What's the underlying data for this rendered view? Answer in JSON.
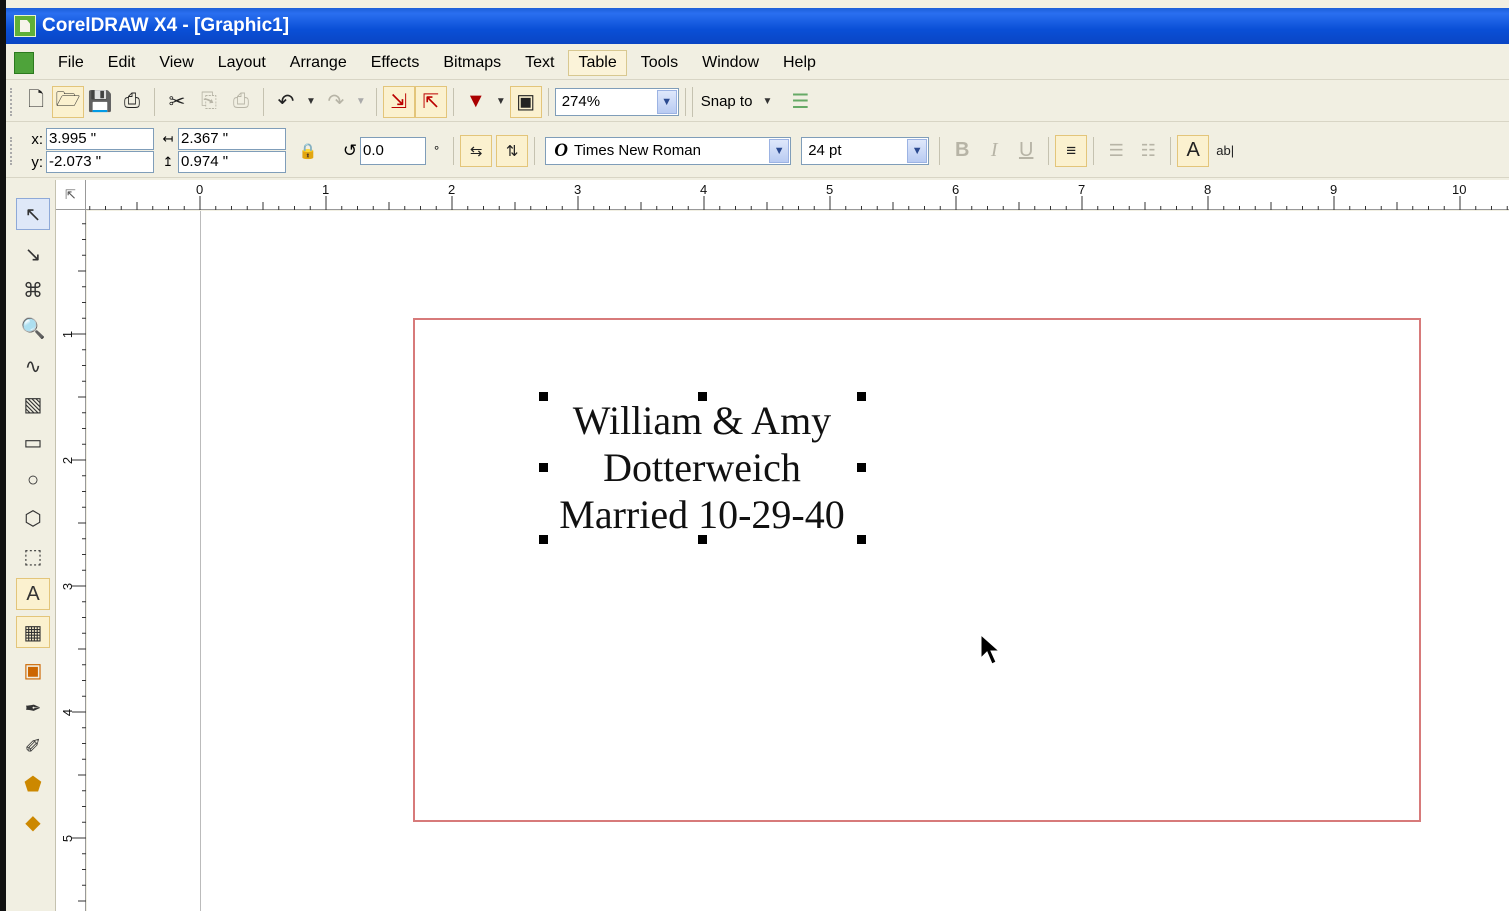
{
  "window": {
    "title": "CorelDRAW X4 - [Graphic1]"
  },
  "menu": {
    "items": [
      "File",
      "Edit",
      "View",
      "Layout",
      "Arrange",
      "Effects",
      "Bitmaps",
      "Text",
      "Table",
      "Tools",
      "Window",
      "Help"
    ],
    "active": "Table"
  },
  "standard_toolbar": {
    "zoom": "274%",
    "snap_to": "Snap to",
    "icons": [
      "new-icon",
      "open-icon",
      "save-icon",
      "print-icon",
      "cut-icon",
      "copy-icon",
      "paste-icon",
      "undo-icon",
      "redo-icon",
      "import-icon",
      "export-icon",
      "application-launcher-icon",
      "welcome-screen-icon",
      "options-icon"
    ]
  },
  "property_bar": {
    "x_label": "x:",
    "x_value": "3.995 \"",
    "y_label": "y:",
    "y_value": "-2.073 \"",
    "width_value": "2.367 \"",
    "height_value": "0.974 \"",
    "angle_value": "0.0",
    "degree_symbol": "°",
    "font_name": "Times New Roman",
    "font_size": "24 pt"
  },
  "rulers": {
    "horizontal": [
      "0",
      "1",
      "2",
      "3",
      "4",
      "5",
      "6",
      "7",
      "8",
      "9",
      "10"
    ],
    "vertical": [
      "1",
      "2",
      "3",
      "4",
      "5"
    ]
  },
  "document": {
    "text_lines": [
      "William & Amy",
      "Dotterweich",
      "Married 10-29-40"
    ]
  },
  "colors": {
    "titlebar": "#0a4fd6",
    "page_border": "#d77a7a",
    "chrome": "#f1efe2"
  }
}
